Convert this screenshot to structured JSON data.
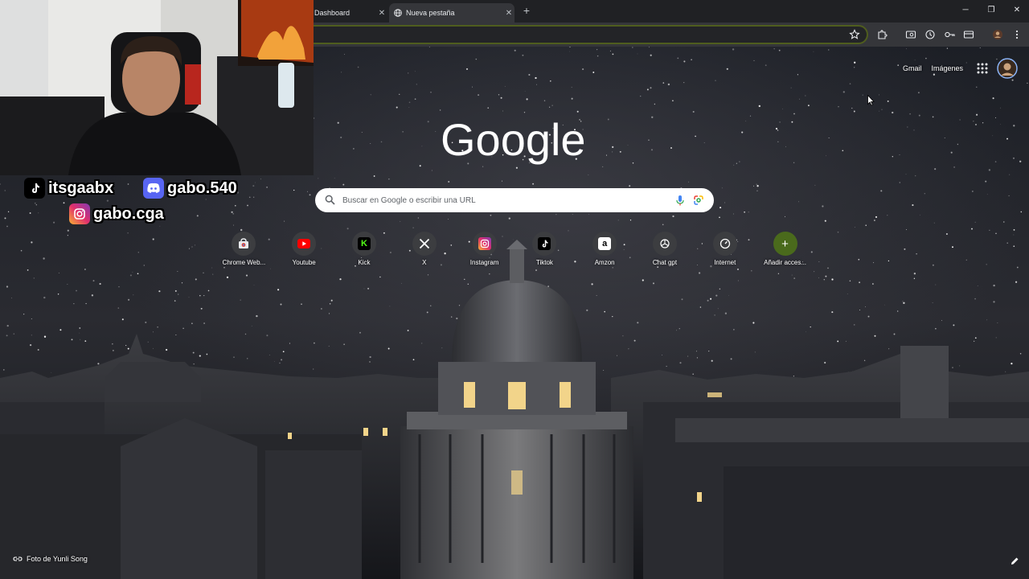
{
  "tabs": [
    {
      "label": "Dashboard",
      "active": false
    },
    {
      "label": "Nueva pestaña",
      "active": true
    }
  ],
  "window_controls": {
    "minimize": "─",
    "restore": "❐",
    "close": "✕"
  },
  "omnibox": {
    "value": ""
  },
  "toolbar_icons": [
    "star-icon",
    "extensions-icon",
    "tab-search-icon",
    "history-icon",
    "passwords-icon",
    "payments-icon",
    "profile-icon",
    "menu-icon"
  ],
  "overlay": {
    "socials": [
      {
        "platform": "tiktok",
        "handle": "itsgaabx"
      },
      {
        "platform": "discord",
        "handle": "gabo.540"
      },
      {
        "platform": "instagram",
        "handle": "gabo.cga"
      }
    ]
  },
  "ntp": {
    "top_links": {
      "gmail": "Gmail",
      "images": "Imágenes"
    },
    "logo_text": "Google",
    "search_placeholder": "Buscar en Google o escribir una URL",
    "shortcuts": [
      {
        "label": "Chrome Web...",
        "icon": "chrome-web-store-icon",
        "color": "#e8eaed"
      },
      {
        "label": "Youtube",
        "icon": "youtube-icon",
        "color": "#ff0000"
      },
      {
        "label": "Kick",
        "icon": "kick-icon",
        "color": "#53fc18"
      },
      {
        "label": "X",
        "icon": "x-icon",
        "color": "#000000"
      },
      {
        "label": "Instagram",
        "icon": "instagram-icon",
        "color": "#e1306c"
      },
      {
        "label": "Tiktok",
        "icon": "tiktok-icon",
        "color": "#000000"
      },
      {
        "label": "Amzon",
        "icon": "amazon-icon",
        "color": "#ffffff"
      },
      {
        "label": "Chat gpt",
        "icon": "chatgpt-icon",
        "color": "#ffffff"
      },
      {
        "label": "Internet",
        "icon": "speedometer-icon",
        "color": "#ffffff"
      },
      {
        "label": "Añadir acces...",
        "icon": "plus-icon",
        "color": "#ffffff"
      }
    ],
    "photo_credit": "Foto de Yunli Song"
  },
  "colors": {
    "accent_green": "#4f5d1e",
    "chrome_dark": "#202124",
    "toolbar": "#35363a"
  }
}
